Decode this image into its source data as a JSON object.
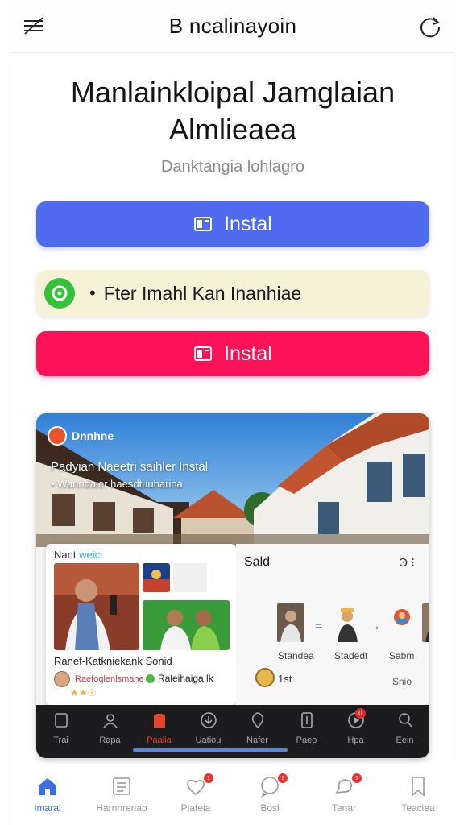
{
  "header": {
    "title": "B ncalinayoin",
    "menu_icon": "menu-icon",
    "refresh_icon": "refresh-icon"
  },
  "headline": {
    "line1": "Manlainkloipal Jamglaian",
    "line2": "Almlieaea"
  },
  "subtitle": "Danktangia lohlagro",
  "buttons": {
    "install_primary": {
      "label": "Instal",
      "icon": "install-icon",
      "color": "#4f6cf0"
    },
    "install_secondary": {
      "label": "Instal",
      "icon": "install-icon",
      "color": "#fb1257"
    }
  },
  "notice": {
    "bullet": "•",
    "text": "Fter Imahl Kan Inanhiae",
    "icon": "chat-badge-icon",
    "color": "#34c23d"
  },
  "preview": {
    "brand": "Dnnhne",
    "hero_title": "Padyian Naeetri saihler Instal",
    "hero_subtitle": "• Wanndaier haesdtuuharina",
    "left_panel": {
      "title_a": "Nant",
      "title_b": "weicr",
      "caption": "Ranef-Katkniekank Sonid",
      "author": "Raefoqlenlsmahe",
      "right_name": "Raleihaiga lk",
      "stars": "★★☉"
    },
    "right_panel": {
      "title": "Sald",
      "more": "Ͽ ⁝",
      "symbols": [
        "=",
        "→"
      ],
      "labels": [
        "Standea",
        "Stadedt",
        "Sabm"
      ],
      "footer_left": "1st",
      "footer_right": "Snio",
      "close_mark": "✗"
    },
    "dark_nav": [
      {
        "label": "Trai",
        "icon": "frame-icon",
        "active": false
      },
      {
        "label": "Rapa",
        "icon": "user-icon",
        "active": false
      },
      {
        "label": "Paalia",
        "icon": "shirt-icon",
        "active": true
      },
      {
        "label": "Uatiou",
        "icon": "download-circle-icon",
        "active": false
      },
      {
        "label": "Nafer",
        "icon": "location-icon",
        "active": false
      },
      {
        "label": "Paeo",
        "icon": "document-icon",
        "active": false
      },
      {
        "label": "Hpa",
        "icon": "play-icon",
        "active": false,
        "badge": "0"
      },
      {
        "label": "Eein",
        "icon": "search-icon",
        "active": false
      }
    ]
  },
  "bottom_nav": [
    {
      "label": "Imaral",
      "icon": "home-icon",
      "active": true
    },
    {
      "label": "Harnnrenab",
      "icon": "list-icon",
      "active": false
    },
    {
      "label": "Plateia",
      "icon": "heart-icon",
      "active": false,
      "badge": "1"
    },
    {
      "label": "Bosl",
      "icon": "message-icon",
      "active": false,
      "badge": "1"
    },
    {
      "label": "Tanar",
      "icon": "chat-icon",
      "active": false,
      "badge": "1"
    },
    {
      "label": "Teaciea",
      "icon": "bookmark-icon",
      "active": false
    }
  ]
}
